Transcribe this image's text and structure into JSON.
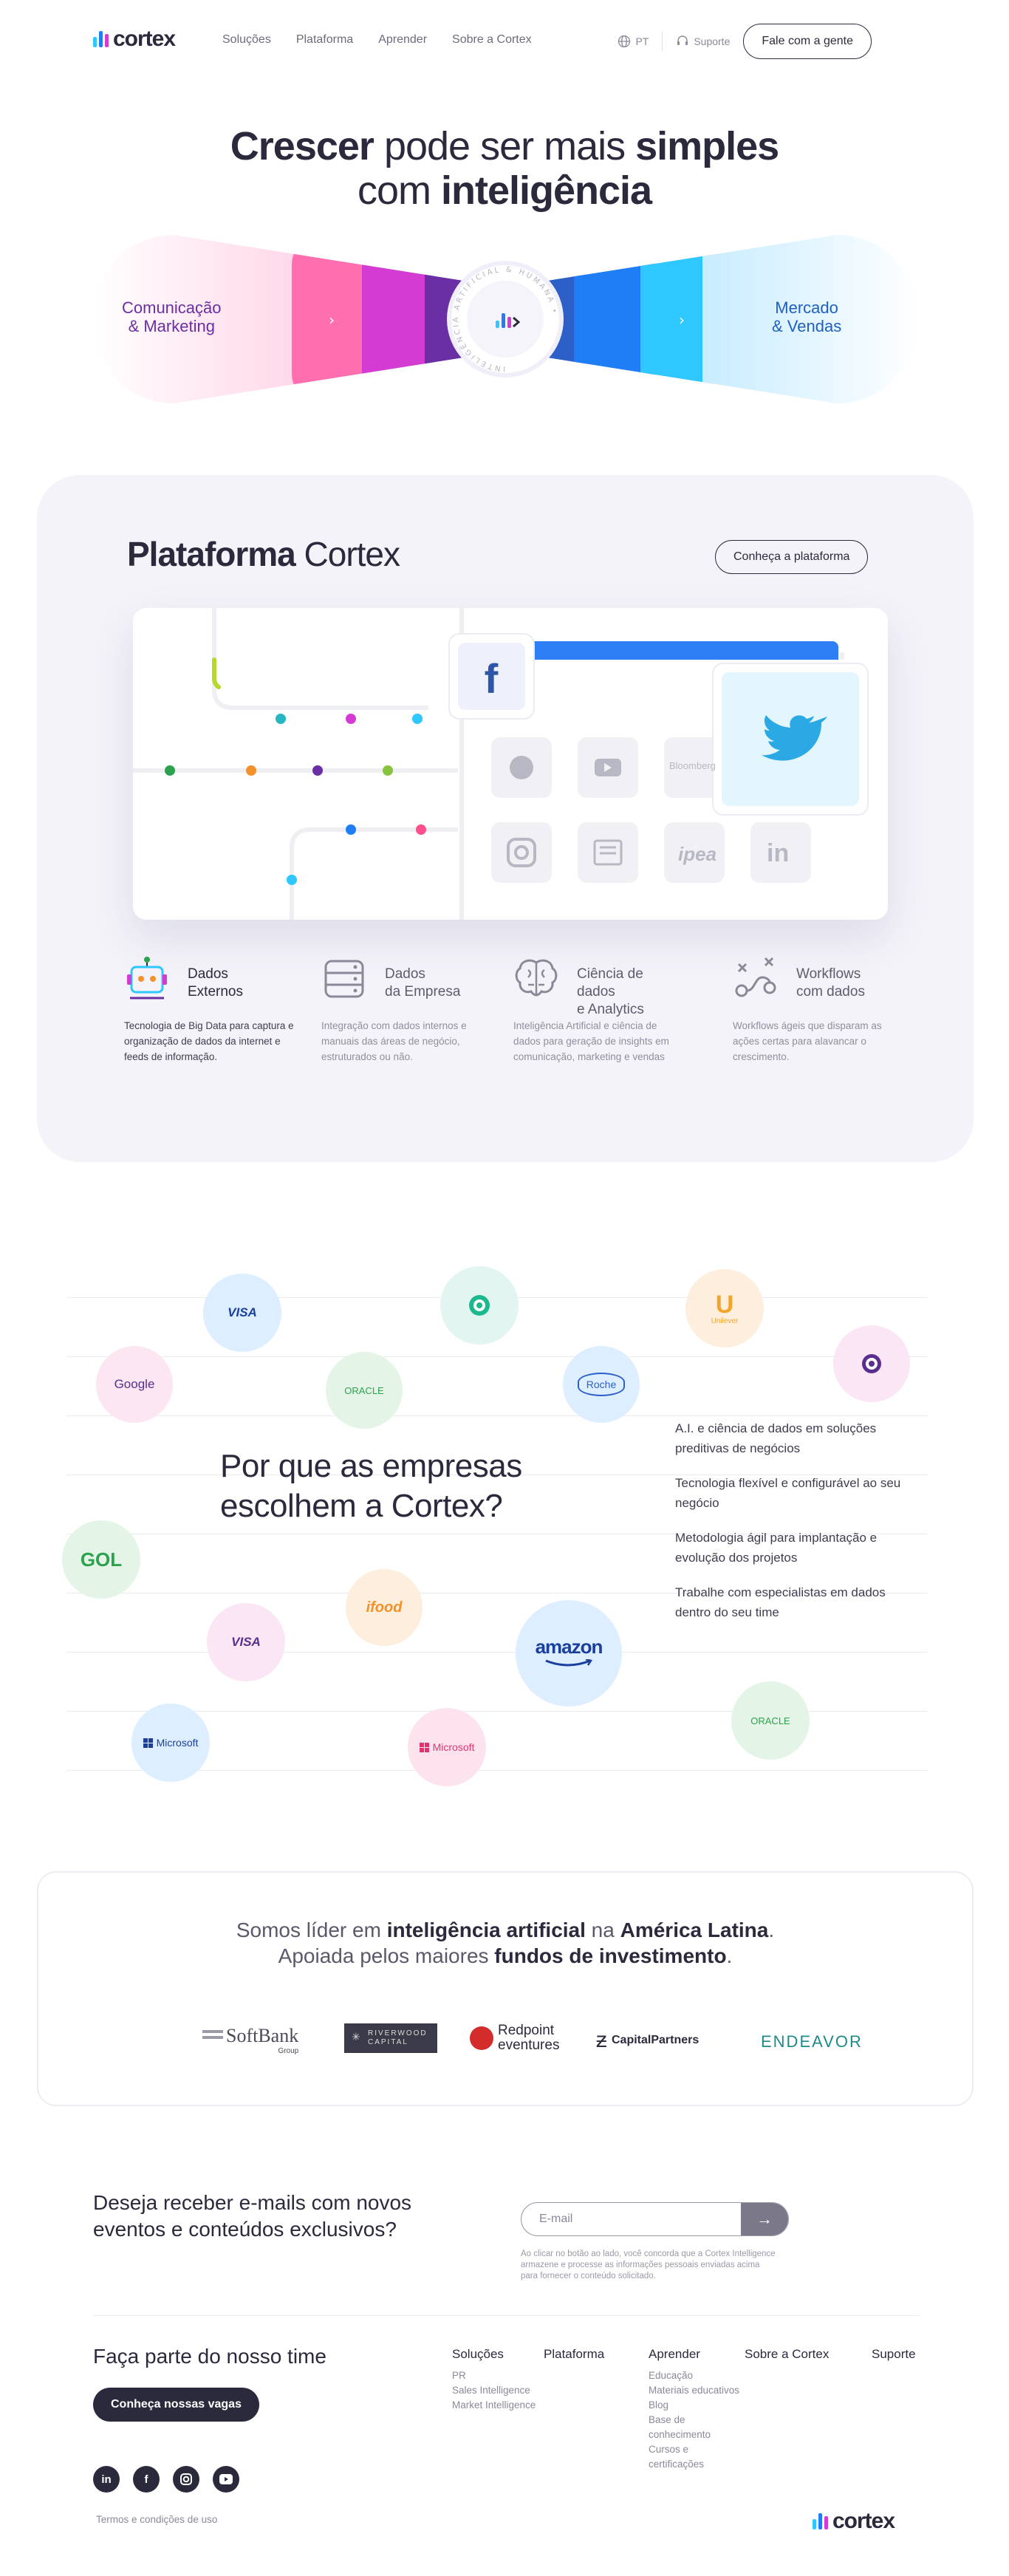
{
  "header": {
    "logo": "cortex",
    "nav": [
      "Soluções",
      "Plataforma",
      "Aprender",
      "Sobre a Cortex"
    ],
    "lang": "PT",
    "support": "Suporte",
    "contact_button": "Fale com a gente"
  },
  "hero": {
    "title_part1_bold": "Crescer",
    "title_part2": " pode ser mais ",
    "title_part3_bold": "simples",
    "title_part4": "com ",
    "title_part5_bold": "inteligência",
    "left_label_1": "Comunicação",
    "left_label_2": "& Marketing",
    "right_label_1": "Mercado",
    "right_label_2": "& Vendas",
    "center_ring_text": "INTELIGÊNCIA ARTIFICIAL & HUMANA •"
  },
  "platform": {
    "title_bold": "Plataforma",
    "title_rest": " Cortex",
    "button": "Conheça a plataforma",
    "card_logos": [
      "Bloomberg",
      "ipea",
      "in"
    ],
    "features": [
      {
        "title_1": "Dados",
        "title_2": "Externos",
        "text": "Tecnologia de Big Data para captura e organização de dados da internet e feeds de informação."
      },
      {
        "title_1": "Dados",
        "title_2": "da Empresa",
        "text": "Integração com dados internos e manuais das áreas de negócio, estruturados ou não."
      },
      {
        "title_1": "Ciência de dados",
        "title_2": "e Analytics",
        "text": "Inteligência Artificial e ciência de dados para geração de insights em comunicação, marketing e vendas"
      },
      {
        "title_1": "Workflows",
        "title_2": "com dados",
        "text": "Workflows ágeis que disparam as ações certas para alavancar o crescimento."
      }
    ]
  },
  "why": {
    "title_1": "Por que as empresas",
    "title_2": "escolhem a Cortex?",
    "reasons": [
      "A.I. e ciência de dados em soluções preditivas de negócios",
      "Tecnologia flexível e configurável ao seu negócio",
      "Metodologia ágil para implantação e evolução dos projetos",
      "Trabalhe com especialistas em dados dentro do seu time"
    ],
    "clients": [
      "VISA",
      "Google",
      "ORACLE",
      "Roche",
      "Unilever",
      "GOL",
      "ifood",
      "amazon",
      "Microsoft"
    ]
  },
  "investors": {
    "line1_a": "Somos líder em ",
    "line1_b": "inteligência artificial",
    "line1_c": " na ",
    "line1_d": "América Latina",
    "line1_e": ".",
    "line2_a": "Apoiada pelos maiores ",
    "line2_b": "fundos de investimento",
    "line2_c": ".",
    "logos": [
      "SoftBank",
      "Group",
      "RIVERWOOD",
      "CAPITAL",
      "Redpoint",
      "eventures",
      "CapitalPartners",
      "ENDEAVOR"
    ]
  },
  "newsletter": {
    "question_1": "Deseja receber e-mails com novos",
    "question_2": "eventos e conteúdos exclusivos?",
    "placeholder": "E-mail",
    "submit": "→",
    "disclaimer": "Ao clicar no botão ao lado, você concorda que a Cortex Intelligence armazene e processe as informações pessoais enviadas acima para fornecer o conteúdo solicitado."
  },
  "footer": {
    "join_title": "Faça parte do nosso time",
    "jobs_button": "Conheça nossas vagas",
    "columns": [
      {
        "title": "Soluções",
        "links": [
          "PR",
          "Sales Intelligence",
          "Market Intelligence"
        ]
      },
      {
        "title": "Plataforma",
        "links": []
      },
      {
        "title": "Aprender",
        "links": [
          "Educação",
          "Materiais educativos",
          "Blog",
          "Base de conhecimento",
          "Cursos e certificações"
        ]
      },
      {
        "title": "Sobre a Cortex",
        "links": []
      },
      {
        "title": "Suporte",
        "links": []
      }
    ],
    "terms": "Termos e condições de uso",
    "logo": "cortex"
  },
  "colors": {
    "navy": "#2b2a3d",
    "pink": "#ff5fa8",
    "magenta": "#d43bd2",
    "purple": "#6a2fa5",
    "blue": "#1f7ef5",
    "cyan": "#2fc7ff",
    "panel": "#f4f3f9"
  }
}
